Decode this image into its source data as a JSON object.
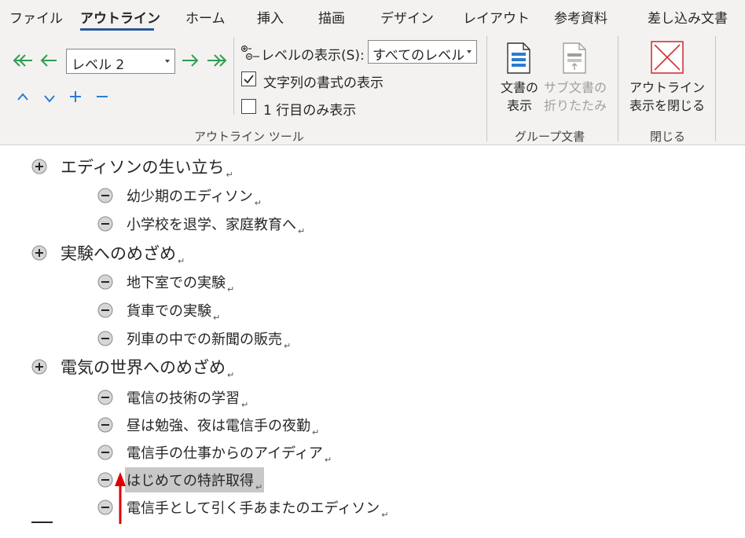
{
  "tabs": [
    {
      "label": "ファイル",
      "active": false
    },
    {
      "label": "アウトライン",
      "active": true
    },
    {
      "label": "ホーム",
      "active": false
    },
    {
      "label": "挿入",
      "active": false
    },
    {
      "label": "描画",
      "active": false
    },
    {
      "label": "デザイン",
      "active": false
    },
    {
      "label": "レイアウト",
      "active": false
    },
    {
      "label": "参考資料",
      "active": false
    },
    {
      "label": "差し込み文書",
      "active": false
    }
  ],
  "ribbon": {
    "outline_tools": {
      "level_value": "レベル 2",
      "show_level_label": "レベルの表示(S):",
      "show_level_value": "すべてのレベル",
      "show_formatting_label": "文字列の書式の表示",
      "show_formatting_checked": true,
      "first_line_only_label": "1 行目のみ表示",
      "first_line_only_checked": false,
      "group_label": "アウトライン ツール"
    },
    "master_document": {
      "show_document_label_1": "文書の",
      "show_document_label_2": "表示",
      "collapse_subdocs_label_1": "サブ文書の",
      "collapse_subdocs_label_2": "折りたたみ",
      "group_label": "グループ文書"
    },
    "close": {
      "close_outline_label_1": "アウトライン",
      "close_outline_label_2": "表示を閉じる",
      "group_label": "閉じる"
    }
  },
  "icons": {
    "promote_heading": "double-left-arrow-icon",
    "promote": "left-arrow-icon",
    "demote": "right-arrow-icon",
    "demote_body": "double-right-arrow-icon",
    "move_up": "chevron-up-icon",
    "move_down": "chevron-down-icon",
    "expand": "plus-icon",
    "collapse": "minus-icon",
    "close": "red-x-icon"
  },
  "colors": {
    "accent_green": "#2e9e4f",
    "accent_blue": "#2b7cd3",
    "close_red": "#d13438",
    "highlight": "#c8c8c8",
    "annotation_arrow": "#e00000",
    "tab_underline": "#2b579a"
  },
  "outline": [
    {
      "level": 1,
      "text": "エディソンの生い立ち",
      "mark": "↵"
    },
    {
      "level": 2,
      "text": "幼少期のエディソン",
      "mark": "↵"
    },
    {
      "level": 2,
      "text": "小学校を退学、家庭教育へ",
      "mark": "↵"
    },
    {
      "level": 1,
      "text": "実験へのめざめ",
      "mark": "↵"
    },
    {
      "level": 2,
      "text": "地下室での実験",
      "mark": "↵"
    },
    {
      "level": 2,
      "text": "貨車での実験",
      "mark": "↵"
    },
    {
      "level": 2,
      "text": "列車の中での新聞の販売",
      "mark": "↵"
    },
    {
      "level": 1,
      "text": "電気の世界へのめざめ",
      "mark": "↵"
    },
    {
      "level": 2,
      "text": "電信の技術の学習",
      "mark": "↵"
    },
    {
      "level": 2,
      "text": "昼は勉強、夜は電信手の夜勤",
      "mark": "↵"
    },
    {
      "level": 2,
      "text": "電信手の仕事からのアイディア",
      "mark": "↵"
    },
    {
      "level": 2,
      "text": "はじめての特許取得",
      "mark": "↵",
      "selected": true
    },
    {
      "level": 2,
      "text": "電信手として引く手あまたのエディソン",
      "mark": "↵"
    }
  ]
}
